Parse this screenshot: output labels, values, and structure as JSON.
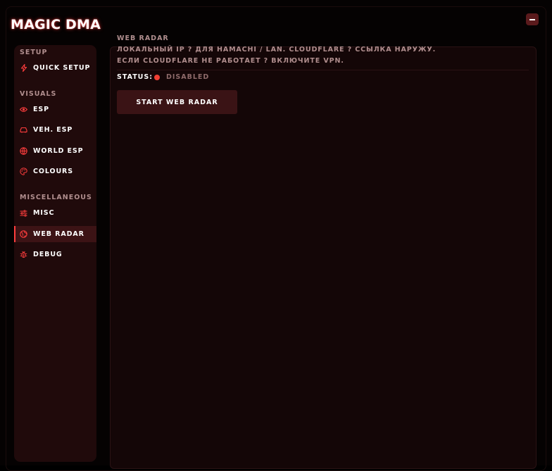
{
  "app": {
    "title": "MAGIC DMA"
  },
  "window_controls": {
    "minimize_icon": "minimize-icon"
  },
  "sidebar": {
    "sections": [
      {
        "label": "SETUP",
        "items": [
          {
            "label": "QUICK SETUP",
            "icon": "lightning-icon"
          }
        ]
      },
      {
        "label": "VISUALS",
        "items": [
          {
            "label": "ESP",
            "icon": "eye-icon"
          },
          {
            "label": "VEH. ESP",
            "icon": "car-icon"
          },
          {
            "label": "WORLD ESP",
            "icon": "globe-icon"
          },
          {
            "label": "COLOURS",
            "icon": "palette-icon"
          }
        ]
      },
      {
        "label": "MISCELLANEOUS",
        "items": [
          {
            "label": "MISC",
            "icon": "sliders-icon"
          },
          {
            "label": "WEB RADAR",
            "icon": "web-globe-icon",
            "active": true
          },
          {
            "label": "DEBUG",
            "icon": "bug-icon"
          }
        ]
      }
    ]
  },
  "main": {
    "header": "WEB RADAR",
    "info_lines": [
      "ЛОКАЛЬНЫЙ IP ? ДЛЯ HAMACHI / LAN. CLOUDFLARE ? ССЫЛКА НАРУЖУ.",
      "ЕСЛИ CLOUDFLARE НЕ РАБОТАЕТ ? ВКЛЮЧИТЕ VPN."
    ],
    "status": {
      "label": "STATUS:",
      "value": "DISABLED",
      "dot_color": "#ef3f34"
    },
    "start_button": "START WEB RADAR"
  },
  "colors": {
    "accent": "#ff3d3d",
    "background": "#050202",
    "sidebar": "#200a0b",
    "panel": "#140607",
    "active_item": "#3c1315",
    "muted_text": "#b08e8e"
  }
}
